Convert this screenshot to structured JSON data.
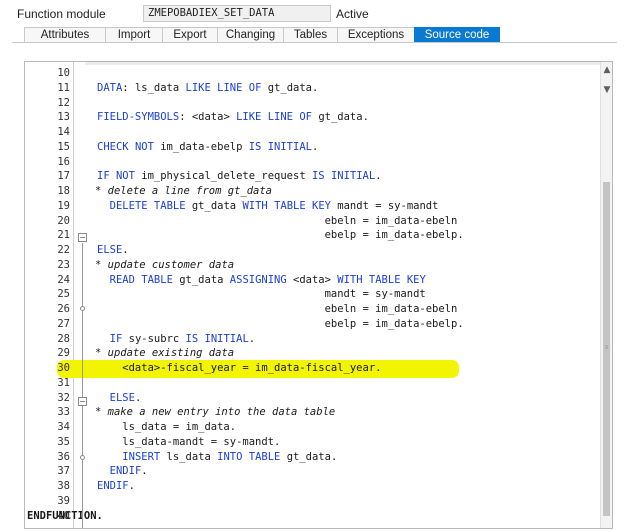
{
  "header": {
    "label": "Function module",
    "name": "ZMEPOBADIEX_SET_DATA",
    "status": "Active"
  },
  "tabs": [
    {
      "label": "Attributes",
      "active": false
    },
    {
      "label": "Import",
      "active": false
    },
    {
      "label": "Export",
      "active": false
    },
    {
      "label": "Changing",
      "active": false
    },
    {
      "label": "Tables",
      "active": false
    },
    {
      "label": "Exceptions",
      "active": false
    },
    {
      "label": "Source code",
      "active": true
    }
  ],
  "colors": {
    "active_tab": "#0a79d2",
    "keyword": "#1a3fd4",
    "comment": "#7a7a7a",
    "highlight": "#f2f400"
  },
  "scrollbar": {
    "up_icon": "triangle-up-icon",
    "down_icon": "triangle-down-icon"
  },
  "highlighted_line": 30,
  "lines": [
    {
      "n": "10",
      "code": ""
    },
    {
      "n": "11",
      "code": "DATA: ls_data LIKE LINE OF gt_data."
    },
    {
      "n": "12",
      "code": ""
    },
    {
      "n": "13",
      "code": "FIELD-SYMBOLS: <data> LIKE LINE OF gt_data."
    },
    {
      "n": "14",
      "code": ""
    },
    {
      "n": "15",
      "code": "CHECK NOT im_data-ebelp IS INITIAL."
    },
    {
      "n": "16",
      "code": ""
    },
    {
      "n": "17",
      "code": "IF NOT im_physical_delete_request IS INITIAL."
    },
    {
      "n": "18",
      "code": "* delete a line from gt_data"
    },
    {
      "n": "19",
      "code": "  DELETE TABLE gt_data WITH TABLE KEY mandt = sy-mandt"
    },
    {
      "n": "20",
      "code": "                                    ebeln = im_data-ebeln"
    },
    {
      "n": "21",
      "code": "                                    ebelp = im_data-ebelp."
    },
    {
      "n": "22",
      "code": "ELSE."
    },
    {
      "n": "23",
      "code": "* update customer data"
    },
    {
      "n": "24",
      "code": "  READ TABLE gt_data ASSIGNING <data> WITH TABLE KEY"
    },
    {
      "n": "25",
      "code": "                                    mandt = sy-mandt"
    },
    {
      "n": "26",
      "code": "                                    ebeln = im_data-ebeln"
    },
    {
      "n": "27",
      "code": "                                    ebelp = im_data-ebelp."
    },
    {
      "n": "28",
      "code": "  IF sy-subrc IS INITIAL."
    },
    {
      "n": "29",
      "code": "* update existing data"
    },
    {
      "n": "30",
      "code": "    <data>-fiscal_year = im_data-fiscal_year."
    },
    {
      "n": "31",
      "code": ""
    },
    {
      "n": "32",
      "code": "  ELSE."
    },
    {
      "n": "33",
      "code": "* make a new entry into the data table"
    },
    {
      "n": "34",
      "code": "    ls_data = im_data."
    },
    {
      "n": "35",
      "code": "    ls_data-mandt = sy-mandt."
    },
    {
      "n": "36",
      "code": "    INSERT ls_data INTO TABLE gt_data."
    },
    {
      "n": "37",
      "code": "  ENDIF."
    },
    {
      "n": "38",
      "code": "ENDIF."
    },
    {
      "n": "39",
      "code": ""
    },
    {
      "n": "40",
      "code": "ENDFUNCTION."
    }
  ]
}
